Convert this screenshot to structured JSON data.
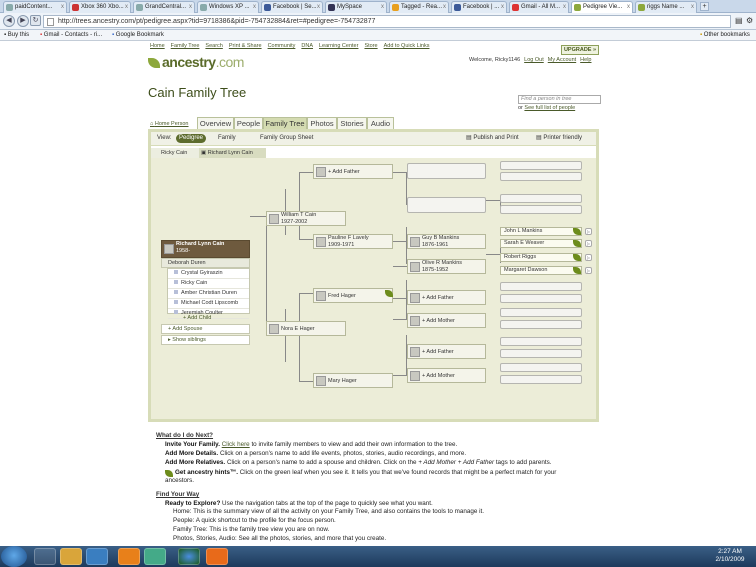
{
  "browser": {
    "tabs": [
      {
        "label": "paidContent..."
      },
      {
        "label": "Xbox 360 Xbo..."
      },
      {
        "label": "GrandCentral..."
      },
      {
        "label": "Windows XP ..."
      },
      {
        "label": "Facebook | Se..."
      },
      {
        "label": "MySpace"
      },
      {
        "label": "Tagged - Rea..."
      },
      {
        "label": "Facebook | ..."
      },
      {
        "label": "Gmail - All M..."
      },
      {
        "label": "Pedigree Vie..."
      },
      {
        "label": "riggs Name ..."
      }
    ],
    "url": "http://trees.ancestry.com/pt/pedigree.aspx?tid=9718386&pid=-754732884&ret=#pedigree=-754732877",
    "bookmarks": [
      "Buy this",
      "Gmail - Contacts - ri...",
      "Google Bookmark"
    ],
    "other_bookmarks": "Other bookmarks"
  },
  "header": {
    "links": [
      "Home",
      "Family Tree",
      "Search",
      "Print & Share",
      "Community",
      "DNA",
      "Learning Center",
      "Store",
      "Add to Quick Links"
    ],
    "upgrade": "UPGRADE »",
    "logo_main": "ancestry",
    "logo_suffix": ".com",
    "welcome": "Welcome, Ricky1146",
    "logout": "Log Out",
    "my_account": "My Account",
    "help": "Help"
  },
  "page": {
    "title": "Cain Family Tree",
    "find_placeholder": "Find a person in tree",
    "see_all_prefix": "or",
    "see_all": "See full list of people",
    "home_person": "Home Person"
  },
  "nav_tabs": [
    "Overview",
    "People",
    "Family Tree",
    "Photos",
    "Stories",
    "Audio"
  ],
  "view_bar": {
    "view_label": "View:",
    "options": [
      "Pedigree",
      "Family",
      "Family Group Sheet"
    ],
    "publish": "Publish and Print",
    "printer": "Printer friendly"
  },
  "breadcrumb": [
    "Ricky Cain",
    "Richard Lynn Cain"
  ],
  "focus_person": {
    "name": "Richard Lynn Cain",
    "years": "1958-",
    "spouse": "Deborah Duren",
    "children": [
      "Crystal Gyiraszin",
      "Ricky Cain",
      "Amber Christian Duren",
      "Michael Codt Lipscomb",
      "Jeremiah Coulter"
    ],
    "add_child": "+ Add Child",
    "add_spouse": "+ Add Spouse",
    "show_siblings": "Show siblings"
  },
  "people": {
    "father": {
      "name": "William T Cain",
      "years": "1927-2002"
    },
    "mother": {
      "name": "Nora E Hager",
      "years": ""
    },
    "pgm": {
      "name": "Pauline F Lavely",
      "years": "1909-1971"
    },
    "mgf": {
      "name": "Fred Hager",
      "years": ""
    },
    "mgm": {
      "name": "Mary Hager",
      "years": ""
    },
    "ggf1": {
      "name": "Guy B Mankins",
      "years": "1876-1961"
    },
    "ggm1": {
      "name": "Olive R Mankins",
      "years": "1875-1952"
    },
    "add_father": "+ Add Father",
    "add_mother": "+ Add Mother",
    "g5": [
      "John L Mankins",
      "Sarah E Weaver",
      "Robert Riggs",
      "Margaret Dawson"
    ]
  },
  "help": {
    "heading": "What do I do Next?",
    "invite_label": "Invite Your Family.",
    "invite_link": "Click here",
    "invite_rest": "to invite family members to view and add their own information to the tree.",
    "details_label": "Add More Details.",
    "details_rest": "Click on a person's name to add life events, photos, stories, audio recordings, and more.",
    "relatives_label": "Add More Relatives.",
    "relatives_rest": "Click on a person's name to add a spouse and children. Click on the",
    "relatives_tags": "+ Add Mother + Add Father",
    "relatives_end": "tags to add parents.",
    "hints_label": "Get ancestry hints™.",
    "hints_rest": "Click on the green leaf when you see it. It tells you that we've found records that might be a perfect match for your",
    "hints_rest2": "ancestors.",
    "find_heading": "Find Your Way",
    "ready_label": "Ready to Explore?",
    "ready_rest": "Use the navigation tabs at the top of the page to quickly see what you want.",
    "home_line": "Home: This is the summary view of all the activity on your Family Tree, and also contains the tools to manage it.",
    "people_line": "People: A quick shortcut to the profile for the focus person.",
    "tree_line": "Family Tree: This is the family tree view you are on now.",
    "photos_line": "Photos, Stories, Audio: See all the photos, stories, and more that you create."
  },
  "taskbar": {
    "time": "2:27 AM",
    "date": "2/10/2009"
  }
}
